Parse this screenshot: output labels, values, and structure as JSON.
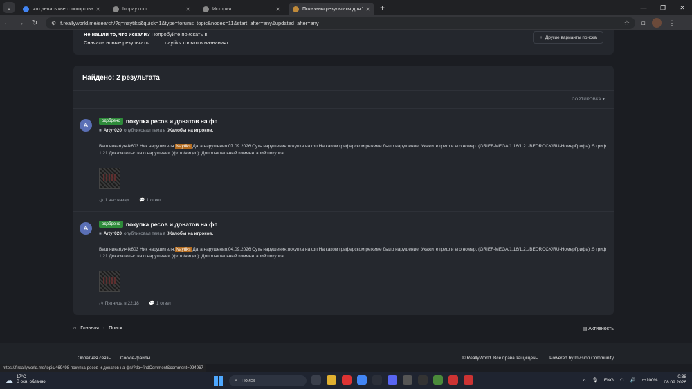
{
  "browser": {
    "tabs": [
      {
        "title": "что делать квест погорговать",
        "active": false,
        "color": "#4285f4"
      },
      {
        "title": "funpay.com",
        "active": false,
        "color": "#8a8a8a"
      },
      {
        "title": "История",
        "active": false,
        "color": "#8a8a8a"
      },
      {
        "title": "Показаны результаты для 'nay",
        "active": true,
        "color": "#c08a3a"
      }
    ],
    "url": "f.reallyworld.me/search/?q=naytiks&quick=1&type=forums_topic&nodes=11&start_after=any&updated_after=any"
  },
  "hint": {
    "question": "Не нашли то, что искали?",
    "suggest": "Попробуйте поискать в:",
    "link_new": "Сначала новые результаты",
    "link_titles": "naytiks только в названиях",
    "more_options": "Другие варианты поиска"
  },
  "results": {
    "heading": "Найдено: 2 результата",
    "sort_label": "СОРТИРОВКА",
    "items": [
      {
        "avatar_letter": "A",
        "badge": "одобрено",
        "title": "покупка ресов и донатов на фп",
        "author": "Artyr020",
        "action": "опубликовал тема в",
        "forum": "Жалобы на игроков.",
        "snippet_before": "Ваш никartyr4ik603 Ник нарушителя:",
        "snippet_highlight": "Naytiks",
        "snippet_after": " Дата нарушения:07.09.2026 Суть нарушения:покупка на фп На каком гриферском режиме было нарушение. Укажите гриф и его номер. (GRIEF-MEGA/1.16/1.21/BEDROCK/RU-НомерГрифа) :5 гриф 1.21 Доказательства о нарушении (фото/видео): Дополнительный комментарий:покупка",
        "time": "1 час назад",
        "replies": "1 ответ"
      },
      {
        "avatar_letter": "A",
        "badge": "одобрено",
        "title": "покупка ресов и донатов на фп",
        "author": "Artyr020",
        "action": "опубликовал тема в",
        "forum": "Жалобы на игроков.",
        "snippet_before": "Ваш никartyr4ik603 Ник нарушителя:",
        "snippet_highlight": "Naytiks",
        "snippet_after": " Дата нарушения:04.09.2026 Суть нарушения:покупка на фп На каком гриферском режиме было нарушение. Укажите гриф и его номер. (GRIEF-MEGA/1.16/1.21/BEDROCK/RU-НомерГрифа) :5 гриф 1.21 Доказательства о нарушении (фото/видео): Дополнительный комментарий:покупка",
        "time": "Пятница в 22:18",
        "replies": "1 ответ"
      }
    ]
  },
  "breadcrumb": {
    "home": "Главная",
    "current": "Поиск"
  },
  "activity": "Активность",
  "footer": {
    "feedback": "Обратная связь",
    "cookies": "Cookie-файлы",
    "copyright": "© ReallyWorld. Все права защищены.",
    "powered": "Powered by Invision Community"
  },
  "status_url": "https://f.reallyworld.me/topic/469498-покупка-ресов-и-донатов-на-фп/?do=findComment&comment=994967",
  "taskbar": {
    "temp": "17°C",
    "weather": "В осн. облачно",
    "search": "Поиск",
    "lang": "ENG",
    "battery": "100%",
    "time": "0:38",
    "date": "08.09.2026"
  }
}
